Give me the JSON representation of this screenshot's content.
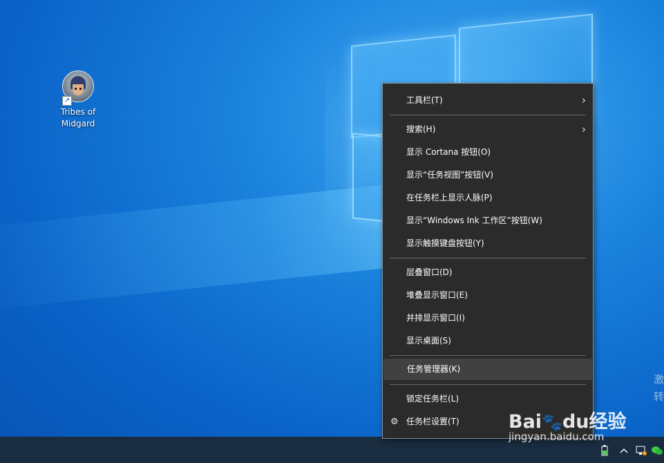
{
  "desktop": {
    "icons": [
      {
        "label_line1": "Tribes of",
        "label_line2": "Midgard"
      }
    ]
  },
  "context_menu": {
    "items": [
      {
        "label": "工具栏(T)",
        "submenu": true
      },
      {
        "label": "搜索(H)",
        "submenu": true
      },
      {
        "label": "显示 Cortana 按钮(O)"
      },
      {
        "label": "显示“任务视图”按钮(V)"
      },
      {
        "label": "在任务栏上显示人脉(P)"
      },
      {
        "label": "显示“Windows Ink 工作区”按钮(W)"
      },
      {
        "label": "显示触摸键盘按钮(Y)"
      },
      {
        "label": "层叠窗口(D)"
      },
      {
        "label": "堆叠显示窗口(E)"
      },
      {
        "label": "并排显示窗口(I)"
      },
      {
        "label": "显示桌面(S)"
      },
      {
        "label": "任务管理器(K)",
        "highlighted": true
      },
      {
        "label": "锁定任务栏(L)"
      },
      {
        "label": "任务栏设置(T)",
        "icon": "gear-icon"
      }
    ]
  },
  "watermark": {
    "brand_part1": "Bai",
    "brand_part2": "du",
    "brand_cn": "经验",
    "url": "jingyan.baidu.com"
  },
  "activate_windows": {
    "line1": "激",
    "line2": "转"
  },
  "tray": {
    "icons": [
      "battery-icon",
      "chevron-up-icon",
      "network-icon",
      "wechat-icon"
    ]
  },
  "colors": {
    "menu_bg": "#2b2b2b",
    "menu_hover": "#414141",
    "taskbar": "#1a2c3f",
    "desktop_accent": "#0a63c8"
  }
}
